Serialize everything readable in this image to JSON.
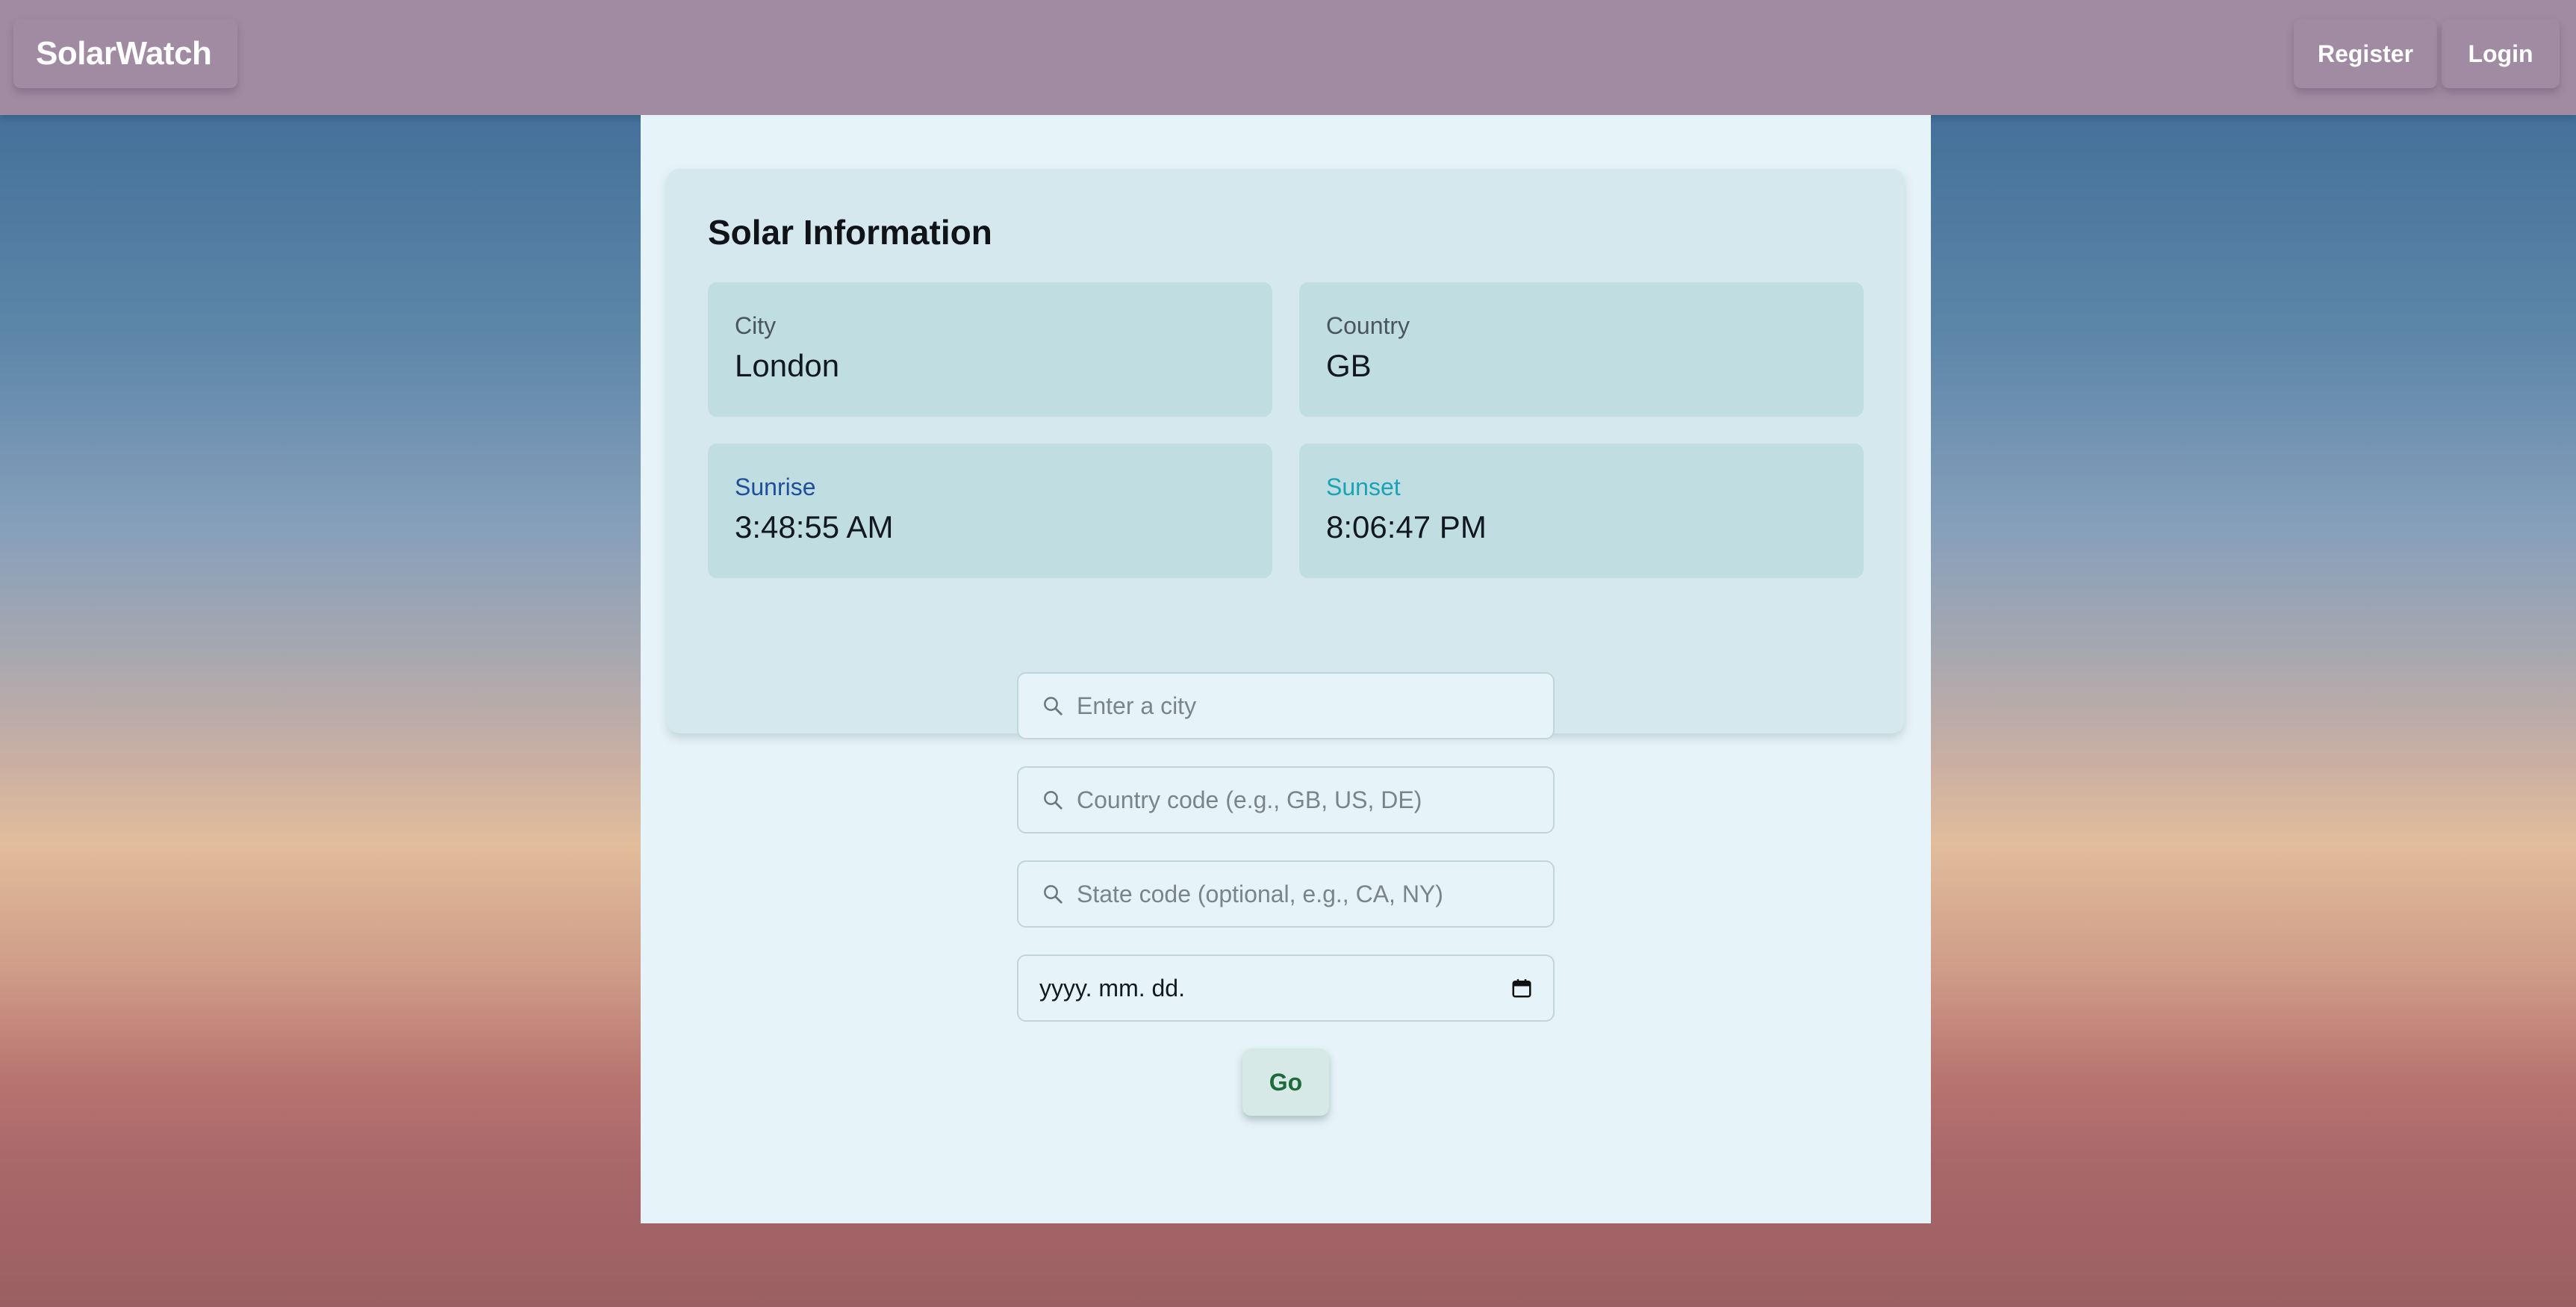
{
  "navbar": {
    "brand": "SolarWatch",
    "register_label": "Register",
    "login_label": "Login"
  },
  "solar_info": {
    "title": "Solar Information",
    "city": {
      "label": "City",
      "value": "London"
    },
    "country": {
      "label": "Country",
      "value": "GB"
    },
    "sunrise": {
      "label": "Sunrise",
      "value": "3:48:55 AM",
      "label_color": "#1f4f9a"
    },
    "sunset": {
      "label": "Sunset",
      "value": "8:06:47 PM",
      "label_color": "#1aa3b5"
    }
  },
  "form": {
    "city_placeholder": "Enter a city",
    "country_placeholder": "Country code (e.g., GB, US, DE)",
    "state_placeholder": "State code (optional, e.g., CA, NY)",
    "date_value": "yyyy. mm. dd.",
    "go_label": "Go"
  },
  "icons": {
    "search": "search-icon",
    "calendar": "calendar-icon"
  },
  "colors": {
    "navbar": "#a08ba2",
    "container": "#e6f3f8",
    "card": "#d4e8ee",
    "tile": "#c0dde2",
    "go_text": "#1d6b3d"
  }
}
